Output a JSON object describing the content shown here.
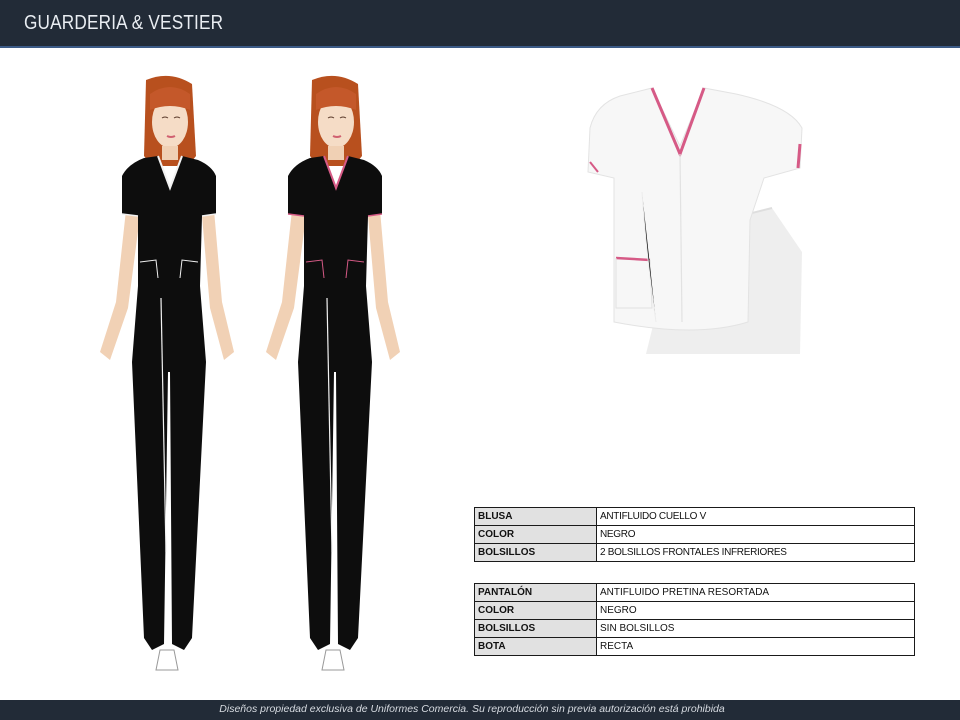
{
  "header": {
    "title": "GUARDERIA & VESTIER"
  },
  "blusa_table": {
    "rows": [
      {
        "label": "BLUSA",
        "value": "ANTIFLUIDO CUELLO V"
      },
      {
        "label": "COLOR",
        "value": "NEGRO"
      },
      {
        "label": "BOLSILLOS",
        "value": "2 BOLSILLOS FRONTALES INFRERIORES"
      }
    ]
  },
  "pantalon_table": {
    "rows": [
      {
        "label": "PANTALÓN",
        "value": "ANTIFLUIDO PRETINA RESORTADA"
      },
      {
        "label": "COLOR",
        "value": "NEGRO"
      },
      {
        "label": "BOLSILLOS",
        "value": "SIN BOLSILLOS"
      },
      {
        "label": "BOTA",
        "value": "RECTA"
      }
    ]
  },
  "footer": {
    "text": "Diseños propiedad exclusiva de Uniformes Comercia. Su reproducción sin previa autorización está prohibida"
  },
  "colors": {
    "header_bg": "#222b37",
    "uniform": "#0d0d0d",
    "trim_white": "#f2f2f2",
    "trim_pink": "#d65a86",
    "skin": "#f2d3b8",
    "hair": "#b8501e"
  }
}
